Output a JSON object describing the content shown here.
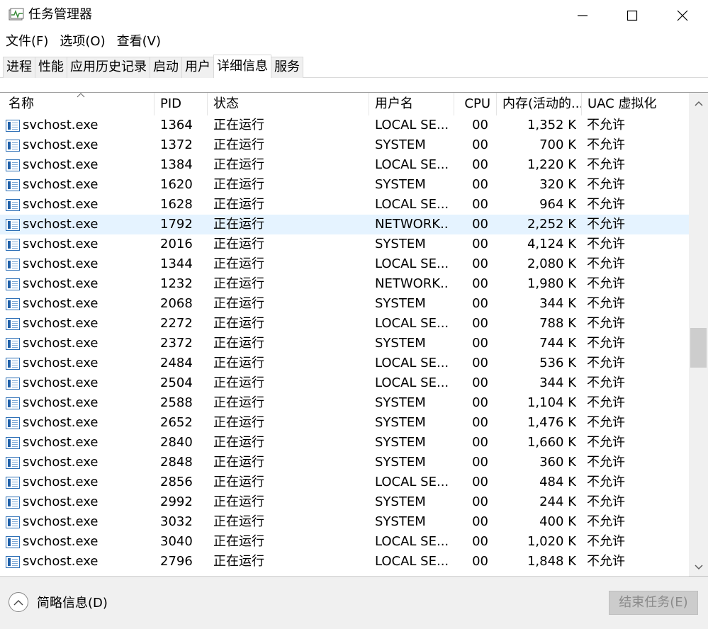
{
  "window": {
    "title": "任务管理器"
  },
  "menu": [
    "文件(F)",
    "选项(O)",
    "查看(V)"
  ],
  "tabs": [
    {
      "label": "进程",
      "active": false
    },
    {
      "label": "性能",
      "active": false
    },
    {
      "label": "应用历史记录",
      "active": false
    },
    {
      "label": "启动",
      "active": false
    },
    {
      "label": "用户",
      "active": false
    },
    {
      "label": "详细信息",
      "active": true
    },
    {
      "label": "服务",
      "active": false
    }
  ],
  "columns": {
    "name": "名称",
    "pid": "PID",
    "status": "状态",
    "user": "用户名",
    "cpu": "CPU",
    "memory": "内存(活动的...",
    "uac": "UAC 虚拟化"
  },
  "rows": [
    {
      "name": "svchost.exe",
      "pid": "1364",
      "status": "正在运行",
      "user": "LOCAL SE...",
      "cpu": "00",
      "memory": "1,352 K",
      "uac": "不允许",
      "selected": false
    },
    {
      "name": "svchost.exe",
      "pid": "1372",
      "status": "正在运行",
      "user": "SYSTEM",
      "cpu": "00",
      "memory": "700 K",
      "uac": "不允许",
      "selected": false
    },
    {
      "name": "svchost.exe",
      "pid": "1384",
      "status": "正在运行",
      "user": "LOCAL SE...",
      "cpu": "00",
      "memory": "1,220 K",
      "uac": "不允许",
      "selected": false
    },
    {
      "name": "svchost.exe",
      "pid": "1620",
      "status": "正在运行",
      "user": "SYSTEM",
      "cpu": "00",
      "memory": "320 K",
      "uac": "不允许",
      "selected": false
    },
    {
      "name": "svchost.exe",
      "pid": "1628",
      "status": "正在运行",
      "user": "LOCAL SE...",
      "cpu": "00",
      "memory": "964 K",
      "uac": "不允许",
      "selected": false
    },
    {
      "name": "svchost.exe",
      "pid": "1792",
      "status": "正在运行",
      "user": "NETWORK...",
      "cpu": "00",
      "memory": "2,252 K",
      "uac": "不允许",
      "selected": true
    },
    {
      "name": "svchost.exe",
      "pid": "2016",
      "status": "正在运行",
      "user": "SYSTEM",
      "cpu": "00",
      "memory": "4,124 K",
      "uac": "不允许",
      "selected": false
    },
    {
      "name": "svchost.exe",
      "pid": "1344",
      "status": "正在运行",
      "user": "LOCAL SE...",
      "cpu": "00",
      "memory": "2,080 K",
      "uac": "不允许",
      "selected": false
    },
    {
      "name": "svchost.exe",
      "pid": "1232",
      "status": "正在运行",
      "user": "NETWORK...",
      "cpu": "00",
      "memory": "1,980 K",
      "uac": "不允许",
      "selected": false
    },
    {
      "name": "svchost.exe",
      "pid": "2068",
      "status": "正在运行",
      "user": "SYSTEM",
      "cpu": "00",
      "memory": "344 K",
      "uac": "不允许",
      "selected": false
    },
    {
      "name": "svchost.exe",
      "pid": "2272",
      "status": "正在运行",
      "user": "LOCAL SE...",
      "cpu": "00",
      "memory": "788 K",
      "uac": "不允许",
      "selected": false
    },
    {
      "name": "svchost.exe",
      "pid": "2372",
      "status": "正在运行",
      "user": "SYSTEM",
      "cpu": "00",
      "memory": "744 K",
      "uac": "不允许",
      "selected": false
    },
    {
      "name": "svchost.exe",
      "pid": "2484",
      "status": "正在运行",
      "user": "LOCAL SE...",
      "cpu": "00",
      "memory": "536 K",
      "uac": "不允许",
      "selected": false
    },
    {
      "name": "svchost.exe",
      "pid": "2504",
      "status": "正在运行",
      "user": "LOCAL SE...",
      "cpu": "00",
      "memory": "344 K",
      "uac": "不允许",
      "selected": false
    },
    {
      "name": "svchost.exe",
      "pid": "2588",
      "status": "正在运行",
      "user": "SYSTEM",
      "cpu": "00",
      "memory": "1,104 K",
      "uac": "不允许",
      "selected": false
    },
    {
      "name": "svchost.exe",
      "pid": "2652",
      "status": "正在运行",
      "user": "SYSTEM",
      "cpu": "00",
      "memory": "1,476 K",
      "uac": "不允许",
      "selected": false
    },
    {
      "name": "svchost.exe",
      "pid": "2840",
      "status": "正在运行",
      "user": "SYSTEM",
      "cpu": "00",
      "memory": "1,660 K",
      "uac": "不允许",
      "selected": false
    },
    {
      "name": "svchost.exe",
      "pid": "2848",
      "status": "正在运行",
      "user": "SYSTEM",
      "cpu": "00",
      "memory": "360 K",
      "uac": "不允许",
      "selected": false
    },
    {
      "name": "svchost.exe",
      "pid": "2856",
      "status": "正在运行",
      "user": "LOCAL SE...",
      "cpu": "00",
      "memory": "484 K",
      "uac": "不允许",
      "selected": false
    },
    {
      "name": "svchost.exe",
      "pid": "2992",
      "status": "正在运行",
      "user": "SYSTEM",
      "cpu": "00",
      "memory": "244 K",
      "uac": "不允许",
      "selected": false
    },
    {
      "name": "svchost.exe",
      "pid": "3032",
      "status": "正在运行",
      "user": "SYSTEM",
      "cpu": "00",
      "memory": "400 K",
      "uac": "不允许",
      "selected": false
    },
    {
      "name": "svchost.exe",
      "pid": "3040",
      "status": "正在运行",
      "user": "LOCAL SE...",
      "cpu": "00",
      "memory": "1,020 K",
      "uac": "不允许",
      "selected": false
    },
    {
      "name": "svchost.exe",
      "pid": "2796",
      "status": "正在运行",
      "user": "LOCAL SE...",
      "cpu": "00",
      "memory": "1,848 K",
      "uac": "不允许",
      "selected": false
    }
  ],
  "scroll": {
    "position_fraction": 0.53,
    "visible_fraction": 0.09
  },
  "footer": {
    "fewer_details": "简略信息(D)",
    "end_task": "结束任务(E)"
  },
  "icons": {
    "app": "task-manager-icon",
    "process": "process-window-icon",
    "minimize": "minimize-icon",
    "maximize": "maximize-icon",
    "close": "close-icon",
    "sort": "sort-ascending-icon",
    "collapse": "chevron-up-icon"
  },
  "colors": {
    "selected_row": "#e5f3ff",
    "disabled_button": "#cccccc"
  }
}
